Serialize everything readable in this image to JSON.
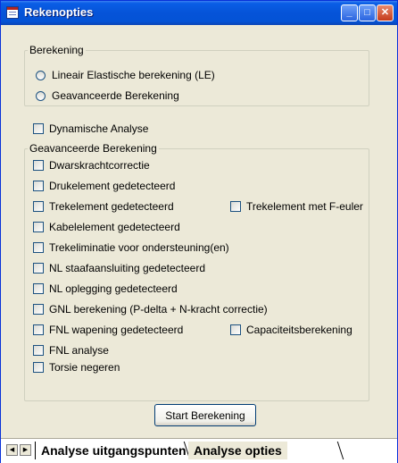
{
  "window": {
    "title": "Rekenopties"
  },
  "berekening": {
    "legend": "Berekening",
    "options": [
      "Lineair Elastische berekening (LE)",
      "Geavanceerde Berekening"
    ]
  },
  "dynamische": {
    "label": "Dynamische Analyse"
  },
  "geavanceerd": {
    "legend": "Geavanceerde Berekening",
    "items": {
      "dwarskracht": "Dwarskrachtcorrectie",
      "drukelement": "Drukelement gedetecteerd",
      "trekelement": "Trekelement gedetecteerd",
      "trek_feuler": "Trekelement met F-euler",
      "kabelelement": "Kabelelement gedetecteerd",
      "trekeliminatie": "Trekeliminatie voor ondersteuning(en)",
      "nl_staaf": "NL staafaansluiting gedetecteerd",
      "nl_oplegging": "NL oplegging gedetecteerd",
      "gnl": "GNL berekening (P-delta + N-kracht correctie)",
      "fnl_wapening": "FNL wapening gedetecteerd",
      "capaciteit": "Capaciteitsberekening",
      "fnl_analyse": "FNL analyse",
      "torsie": "Torsie negeren"
    }
  },
  "start_button": "Start Berekening",
  "tabs": {
    "active": "Analyse uitgangspunten",
    "other": "Analyse opties"
  }
}
